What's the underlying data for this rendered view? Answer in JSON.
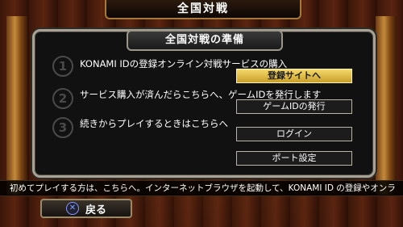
{
  "header": {
    "title": "全国対戦"
  },
  "panel": {
    "title": "全国対戦の準備",
    "rows": [
      {
        "step": "1",
        "text": "KONAMI IDの登録オンライン対戦サービスの購入",
        "button": "登録サイトへ"
      },
      {
        "step": "2",
        "text": "サービス購入が済んだらこちらへ、ゲームIDを発行します",
        "button": "ゲームIDの発行"
      },
      {
        "step": "3",
        "text": "続きからプレイするときはこちらへ",
        "button": "ログイン"
      }
    ],
    "extra_button": "ポート設定"
  },
  "ticker": {
    "text": "初めてプレイする方は、こちらへ。インターネットブラウザを起動して、KONAMI ID の登録やオンラ"
  },
  "footer": {
    "back_label": "戻る",
    "back_icon": "cross-button-icon"
  },
  "colors": {
    "selected_button": "#e0b840",
    "panel_border": "#a7a295"
  }
}
